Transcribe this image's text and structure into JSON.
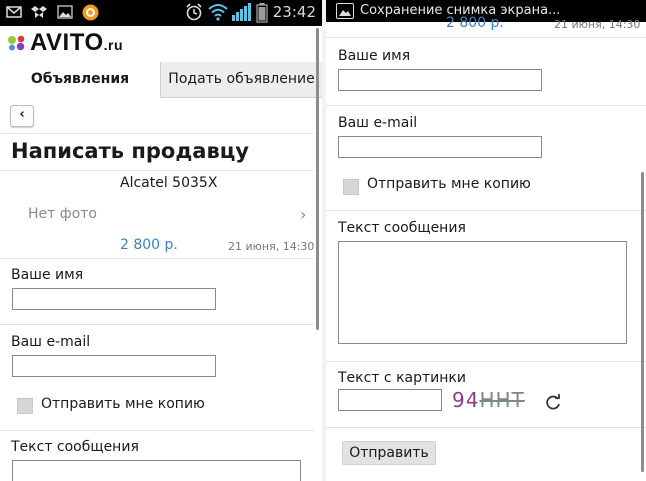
{
  "status_bar": {
    "time": "23:42",
    "icons": [
      "gmail-icon",
      "dropbox-icon",
      "image-icon",
      "app-orange-icon",
      "alarm-icon",
      "wifi-icon",
      "signal-icon",
      "battery-icon"
    ]
  },
  "right_bar": {
    "title": "Сохранение снимка экрана...",
    "icon": "image-icon"
  },
  "logo": {
    "text": "AVITO",
    "suffix": ".ru"
  },
  "tabs": [
    {
      "label": "Объявления",
      "active": true
    },
    {
      "label": "Подать объявление",
      "active": false
    }
  ],
  "page": {
    "back_label": "‹",
    "title": "Написать продавцу"
  },
  "listing": {
    "product": "Alcatel 5035X",
    "no_photo": "Нет фото",
    "price": "2 800 р.",
    "date": "21 июня, 14:30"
  },
  "form": {
    "name_label": "Ваше имя",
    "name_value": "",
    "email_label": "Ваш e-mail",
    "email_value": "",
    "copy_label": "Отправить мне копию",
    "message_label": "Текст сообщения",
    "message_value": "",
    "captcha_label": "Текст с картинки",
    "captcha_value": "",
    "captcha_image_text_a": "94",
    "captcha_image_text_b": "HHT",
    "submit_label": "Отправить"
  },
  "colors": {
    "price": "#3c82c4",
    "status_bar": "#000000",
    "captcha_a": "#8a3d86"
  }
}
